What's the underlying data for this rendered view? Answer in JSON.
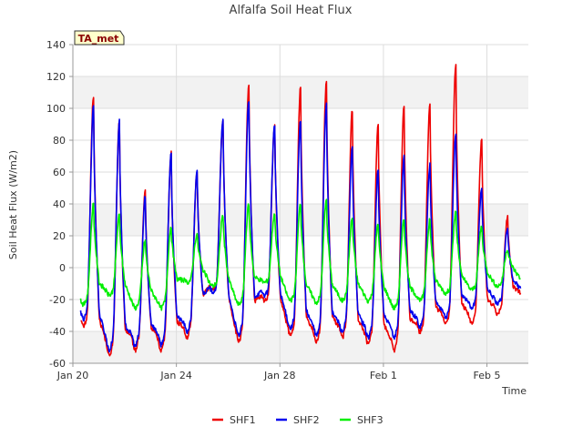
{
  "chart_data": {
    "type": "line",
    "title": "Alfalfa Soil Heat Flux",
    "xlabel": "Time",
    "ylabel": "Soil Heat Flux (W/m2)",
    "badge": "TA_met",
    "ylim": [
      -60,
      140
    ],
    "yticks": [
      -60,
      -40,
      -20,
      0,
      20,
      40,
      60,
      80,
      100,
      120,
      140
    ],
    "xlim": [
      0,
      17.6
    ],
    "xticks": [
      {
        "x": 0,
        "label": "Jan 20"
      },
      {
        "x": 4,
        "label": "Jan 24"
      },
      {
        "x": 8,
        "label": "Jan 28"
      },
      {
        "x": 12,
        "label": "Feb 1"
      },
      {
        "x": 16,
        "label": "Feb 5"
      }
    ],
    "grid": true,
    "legend_position": "bottom",
    "x_units": "days since Jan 20",
    "days": [
      0.3,
      1.3,
      2.3,
      3.3,
      4.3,
      5.3,
      6.3,
      7.3,
      8.3,
      9.3,
      10.3,
      11.3,
      12.3,
      13.3,
      14.3,
      15.3,
      16.3
    ],
    "series": [
      {
        "name": "SHF1",
        "color": "#ee0000",
        "night": [
          -32,
          -48,
          -45,
          -45,
          -38,
          -12,
          -40,
          -18,
          -37,
          -40,
          -38,
          -42,
          -45,
          -35,
          -30,
          -30,
          -25
        ],
        "peak": [
          108,
          92,
          49,
          72,
          61,
          92,
          115,
          89,
          113,
          117,
          99,
          91,
          102,
          104,
          128,
          80,
          32
        ],
        "end": -16
      },
      {
        "name": "SHF2",
        "color": "#0000ee",
        "night": [
          -28,
          -45,
          -43,
          -42,
          -35,
          -13,
          -37,
          -15,
          -33,
          -37,
          -35,
          -38,
          -38,
          -32,
          -27,
          -22,
          -20
        ],
        "peak": [
          102,
          92,
          45,
          72,
          60,
          92,
          105,
          89,
          92,
          103,
          75,
          61,
          70,
          65,
          84,
          50,
          25
        ],
        "end": -13
      },
      {
        "name": "SHF3",
        "color": "#00ee00",
        "night": [
          -20,
          -15,
          -22,
          -22,
          -8,
          -10,
          -20,
          -8,
          -18,
          -19,
          -18,
          -18,
          -22,
          -18,
          -14,
          -12,
          -10
        ],
        "peak": [
          40,
          33,
          17,
          26,
          21,
          33,
          40,
          34,
          40,
          42,
          31,
          28,
          31,
          30,
          35,
          26,
          12
        ],
        "end": -7
      }
    ]
  }
}
